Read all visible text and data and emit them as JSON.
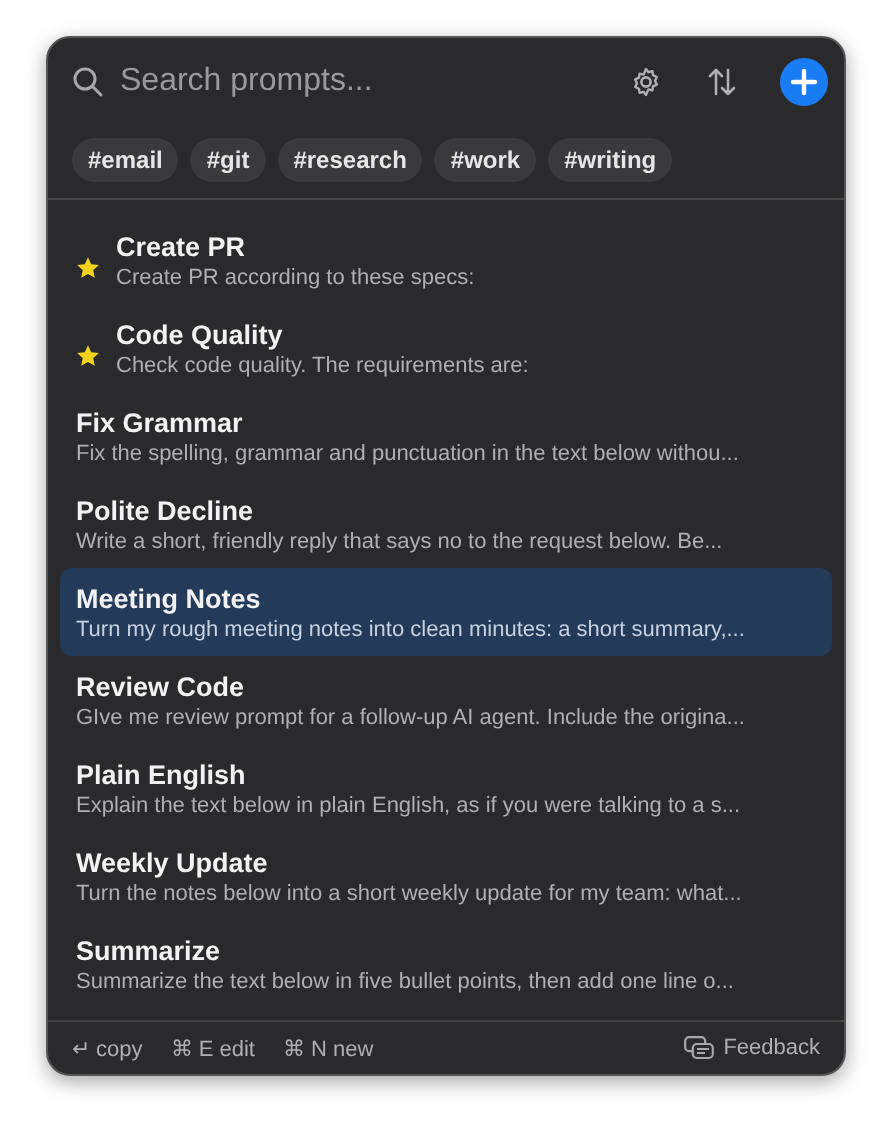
{
  "search": {
    "placeholder": "Search prompts..."
  },
  "tags": [
    {
      "label": "#email"
    },
    {
      "label": "#git"
    },
    {
      "label": "#research"
    },
    {
      "label": "#work"
    },
    {
      "label": "#writing"
    }
  ],
  "prompts": [
    {
      "title": "Create PR",
      "preview": "Create PR according to these specs:",
      "starred": true,
      "selected": false
    },
    {
      "title": "Code Quality",
      "preview": "Check code quality. The requirements are:",
      "starred": true,
      "selected": false
    },
    {
      "title": "Fix Grammar",
      "preview": "Fix the spelling, grammar and punctuation in the text below withou...",
      "starred": false,
      "selected": false
    },
    {
      "title": "Polite Decline",
      "preview": "Write a short, friendly reply that says no to the request below. Be...",
      "starred": false,
      "selected": false
    },
    {
      "title": "Meeting Notes",
      "preview": "Turn my rough meeting notes into clean minutes: a short summary,...",
      "starred": false,
      "selected": true
    },
    {
      "title": "Review Code",
      "preview": "GIve me review prompt for a follow-up AI agent. Include the origina...",
      "starred": false,
      "selected": false
    },
    {
      "title": "Plain English",
      "preview": "Explain the text below in plain English, as if you were talking to a s...",
      "starred": false,
      "selected": false
    },
    {
      "title": "Weekly Update",
      "preview": "Turn the notes below into a short weekly update for my team: what...",
      "starred": false,
      "selected": false
    },
    {
      "title": "Summarize",
      "preview": "Summarize the text below in five bullet points, then add one line o...",
      "starred": false,
      "selected": false
    }
  ],
  "footer": {
    "hints": [
      {
        "key": "↵",
        "label": "copy"
      },
      {
        "key": "⌘ E",
        "label": "edit"
      },
      {
        "key": "⌘ N",
        "label": "new"
      }
    ],
    "feedback": "Feedback"
  }
}
